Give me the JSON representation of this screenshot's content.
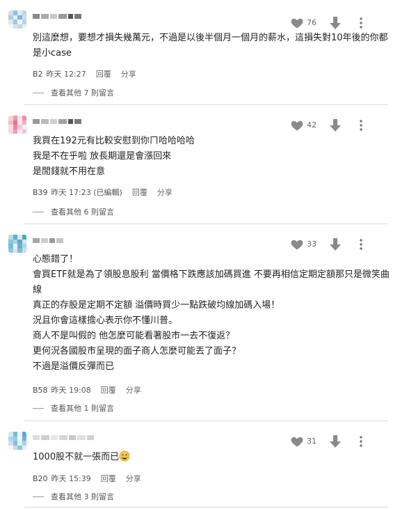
{
  "comments": [
    {
      "floor": "B2",
      "time": "昨天 12:27",
      "likes": "76",
      "lines": [
        "別這麼想，要想才損失幾萬元，不過是以後半個月一個月的薪水，這損失對10年後的你都",
        "是小case"
      ],
      "reply_label": "回覆",
      "share_label": "分享",
      "more_replies": "查看其他 7 則留言",
      "avatar_colors": [
        "#cfe3ee",
        "#8fc3df",
        "#dbe9f0",
        "#b9d7e8",
        "#a9cfe3",
        "#e9f2f6",
        "#7fb5d4",
        "#c8e0ec",
        "#dceaf2",
        "#9ccbe2",
        "#eef5f8",
        "#b5d6e7",
        "#f3f7f9",
        "#d2e6f0",
        "#c0dbe9",
        "#e5eff4"
      ]
    },
    {
      "floor": "B39",
      "time": "昨天 17:23 (已編輯)",
      "likes": "42",
      "lines": [
        "我買在192元有比較安慰到你ㄇ哈哈哈哈",
        "我是不在乎啦 放長期還是會漲回來",
        "是閒錢就不用在意"
      ],
      "reply_label": "回覆",
      "share_label": "分享",
      "more_replies": "查看其他 6 則留言",
      "avatar_colors": [
        "#f4d3dc",
        "#e79ab0",
        "#f7e1e7",
        "#ea8fa8",
        "#f0bfcd",
        "#e2738f",
        "#f8e6eb",
        "#eeb0c1",
        "#f6dbe3",
        "#e889a2",
        "#f2c8d3",
        "#fbeff2",
        "#f5d7df",
        "#ec9fb4",
        "#f9ebef",
        "#f0c2cf"
      ]
    },
    {
      "floor": "B58",
      "time": "昨天 19:08",
      "likes": "33",
      "lines": [
        "心態錯了！",
        "會買ETF就是為了領股息股利 當價格下跌應該加碼買進 不要再相信定期定額那只是微笑曲",
        "線",
        "真正的存股是定期不定額 溢價時買少一點跌破均線加碼入場！",
        "況且你會這樣擔心表示你不懂川普。",
        "商人不是叫假的 他怎麼可能看著股市一去不復返？",
        "更何況各國股市呈現的面子商人怎麼可能丟了面子？",
        "不過是溢價反彈而已"
      ],
      "reply_label": "回覆",
      "share_label": "分享",
      "more_replies": "查看其他 1 則留言",
      "avatar_colors": [
        "#bcdcea",
        "#62aed2",
        "#d9ebf3",
        "#4ea3cc",
        "#8cc4df",
        "#a7d2e6",
        "#5fabd0",
        "#cfe6f1",
        "#78b9d8",
        "#e6f2f8",
        "#6ab2d4",
        "#b1d7e9",
        "#94c8e1",
        "#d3e8f2",
        "#81bedb",
        "#c5e1ee"
      ]
    },
    {
      "floor": "B20",
      "time": "昨天 15:39",
      "likes": "31",
      "lines": [
        "1000股不就一張而已"
      ],
      "reply_label": "回覆",
      "share_label": "分享",
      "more_replies": "查看其他 3 則留言",
      "avatar_colors": [
        "#d6eaf3",
        "#7dbbd9",
        "#e8f3f8",
        "#5da9cf",
        "#b3d8ea",
        "#9bcbe3",
        "#eef6fa",
        "#6fb3d5",
        "#c6e2ef",
        "#88c1dc",
        "#dff0f6",
        "#a5d1e6",
        "#f2f8fb",
        "#bfdfed",
        "#92c6df",
        "#e2f0f6"
      ]
    }
  ],
  "emoji": "grinning-face-with-sweat"
}
